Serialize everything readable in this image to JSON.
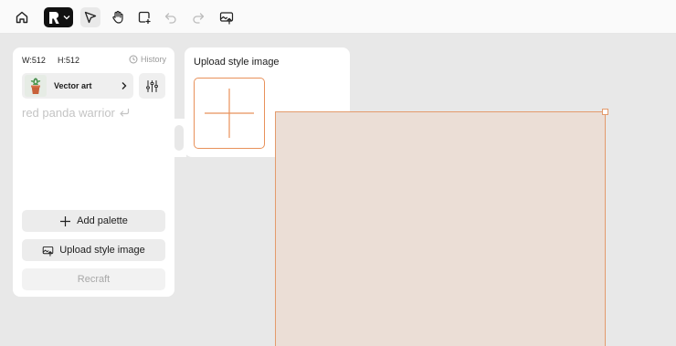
{
  "toolbar": {
    "icons": [
      "home-icon",
      "recraft-logo",
      "chevron-down-icon",
      "select-arrow-icon",
      "hand-icon",
      "frame-add-icon",
      "undo-icon",
      "redo-icon",
      "image-upload-icon"
    ]
  },
  "panel": {
    "width_label": "W:512",
    "height_label": "H:512",
    "history_label": "History",
    "style": {
      "label": "Vector art"
    },
    "prompt_placeholder": "red panda warrior",
    "add_palette_label": "Add palette",
    "upload_style_label": "Upload style image",
    "recraft_label": "Recraft"
  },
  "popover": {
    "title": "Upload style image"
  },
  "colors": {
    "accent": "#e8915a",
    "canvas_bg": "#e8e8e8",
    "artboard_fill": "#ebded6",
    "logo_bg": "#111111"
  }
}
